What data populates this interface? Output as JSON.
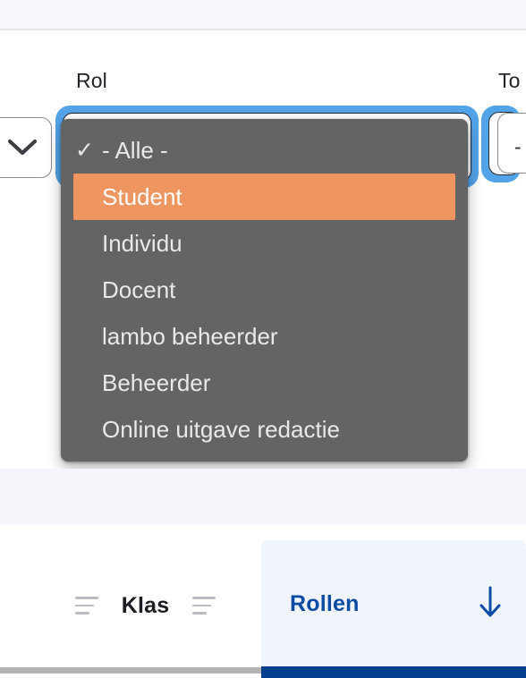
{
  "filter_panel": {
    "fields": [
      {
        "label": "Rol",
        "value": "- Alle -"
      },
      {
        "label": "To",
        "value": "-"
      }
    ],
    "left_select": {
      "value": "",
      "icon": "chevron-down-icon"
    }
  },
  "dropdown": {
    "open_for_field": "Rol",
    "options": [
      {
        "label": "- Alle -",
        "checked": true,
        "highlighted": false
      },
      {
        "label": "Student",
        "checked": false,
        "highlighted": true
      },
      {
        "label": "Individu",
        "checked": false,
        "highlighted": false
      },
      {
        "label": "Docent",
        "checked": false,
        "highlighted": false
      },
      {
        "label": "lambo beheerder",
        "checked": false,
        "highlighted": false
      },
      {
        "label": "Beheerder",
        "checked": false,
        "highlighted": false
      },
      {
        "label": "Online uitgave redactie",
        "checked": false,
        "highlighted": false
      }
    ],
    "check_glyph": "✓",
    "colors": {
      "menu_background": "#646464",
      "highlight": "#ef9560",
      "text": "#e9e9e9",
      "focus_ring": "#52a3e8"
    }
  },
  "table_header": {
    "columns": [
      {
        "label": "Klas",
        "active": false,
        "sort_indicator": "",
        "filter_icon": "sort-filter-icon"
      },
      {
        "label": "Rollen",
        "active": true,
        "sort_indicator": "↓",
        "filter_icon": ""
      }
    ],
    "accent_color": "#04408f"
  }
}
